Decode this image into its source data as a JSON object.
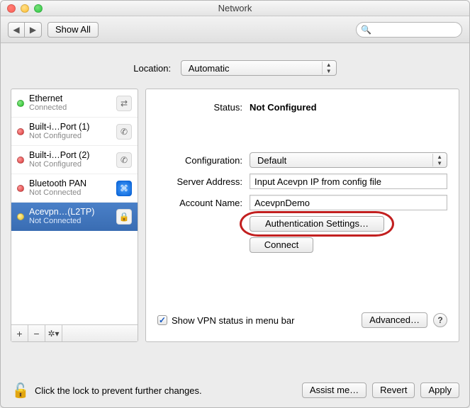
{
  "window": {
    "title": "Network"
  },
  "toolbar": {
    "show_all": "Show All",
    "search_placeholder": ""
  },
  "location": {
    "label": "Location:",
    "value": "Automatic"
  },
  "services": [
    {
      "name": "Ethernet",
      "sub": "Connected",
      "status": "green",
      "icon": "ethernet"
    },
    {
      "name": "Built-i…Port (1)",
      "sub": "Not Configured",
      "status": "red",
      "icon": "phone"
    },
    {
      "name": "Built-i…Port (2)",
      "sub": "Not Configured",
      "status": "red",
      "icon": "phone"
    },
    {
      "name": "Bluetooth PAN",
      "sub": "Not Connected",
      "status": "red",
      "icon": "bluetooth"
    },
    {
      "name": "Acevpn…(L2TP)",
      "sub": "Not Connected",
      "status": "yellow",
      "icon": "lock",
      "selected": true
    }
  ],
  "detail": {
    "status_label": "Status:",
    "status_value": "Not Configured",
    "config_label": "Configuration:",
    "config_value": "Default",
    "server_label": "Server Address:",
    "server_value": "Input Acevpn IP from config file",
    "account_label": "Account Name:",
    "account_value": "AcevpnDemo",
    "auth_btn": "Authentication Settings…",
    "connect_btn": "Connect",
    "show_menubar": "Show VPN status in menu bar",
    "advanced_btn": "Advanced…"
  },
  "footer": {
    "lock_text": "Click the lock to prevent further changes.",
    "assist": "Assist me…",
    "revert": "Revert",
    "apply": "Apply"
  }
}
